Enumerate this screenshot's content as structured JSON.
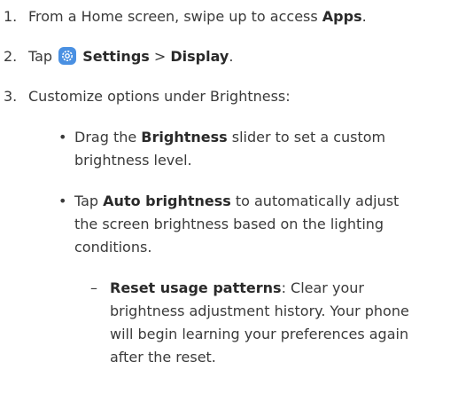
{
  "steps": [
    {
      "number": "1.",
      "text_pre": "From a Home screen, swipe up to access ",
      "bold": "Apps",
      "text_post": "."
    },
    {
      "number": "2.",
      "text_pre": "Tap ",
      "icon": "settings-icon",
      "bold1": "Settings",
      "sep": " > ",
      "bold2": "Display",
      "text_post": "."
    },
    {
      "number": "3.",
      "text": "Customize options under Brightness:"
    }
  ],
  "bullets": [
    {
      "glyph": "•",
      "line1_pre": "Drag the ",
      "line1_bold": "Brightness",
      "line1_post": " slider to set a custom",
      "line2": "brightness level."
    },
    {
      "glyph": "•",
      "line1_pre": "Tap ",
      "line1_bold": "Auto brightness",
      "line1_post": " to automatically adjust",
      "line2": "the screen brightness based on the lighting",
      "line3": "conditions."
    }
  ],
  "subitem": {
    "glyph": "–",
    "bold": "Reset usage patterns",
    "line1_post": ": Clear your",
    "line2": "brightness adjustment history. Your phone",
    "line3": "will begin learning your preferences again",
    "line4": "after the reset."
  }
}
